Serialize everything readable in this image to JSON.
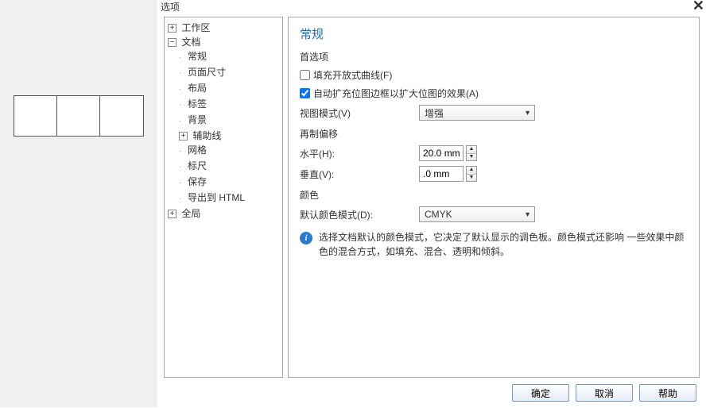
{
  "dialog": {
    "title": "选项",
    "close_label": "✕"
  },
  "tree": {
    "workspace": "工作区",
    "document": "文档",
    "general": "常规",
    "page_size": "页面尺寸",
    "layout": "布局",
    "labels": "标签",
    "background": "背景",
    "guides": "辅助线",
    "grid": "网格",
    "rulers": "标尺",
    "save": "保存",
    "export_html": "导出到 HTML",
    "global": "全局"
  },
  "content": {
    "heading": "常规",
    "preferences_label": "首选项",
    "fill_open_curves": "填充开放式曲线(F)",
    "fill_open_curves_checked": false,
    "auto_expand_bitmap": "自动扩充位图边框以扩大位图的效果(A)",
    "auto_expand_bitmap_checked": true,
    "view_mode_label": "视图模式(V)",
    "view_mode_value": "增强",
    "redraw_offset_label": "再制偏移",
    "horizontal_label": "水平(H):",
    "horizontal_value": "20.0 mm",
    "vertical_label": "垂直(V):",
    "vertical_value": ".0 mm",
    "color_label": "颜色",
    "default_color_mode_label": "默认颜色模式(D):",
    "default_color_mode_value": "CMYK",
    "info_text": "选择文档默认的颜色模式，它决定了默认显示的调色板。颜色模式还影响 一些效果中颜色的混合方式，如填充、混合、透明和倾斜。"
  },
  "buttons": {
    "ok": "确定",
    "cancel": "取消",
    "help": "帮助"
  }
}
